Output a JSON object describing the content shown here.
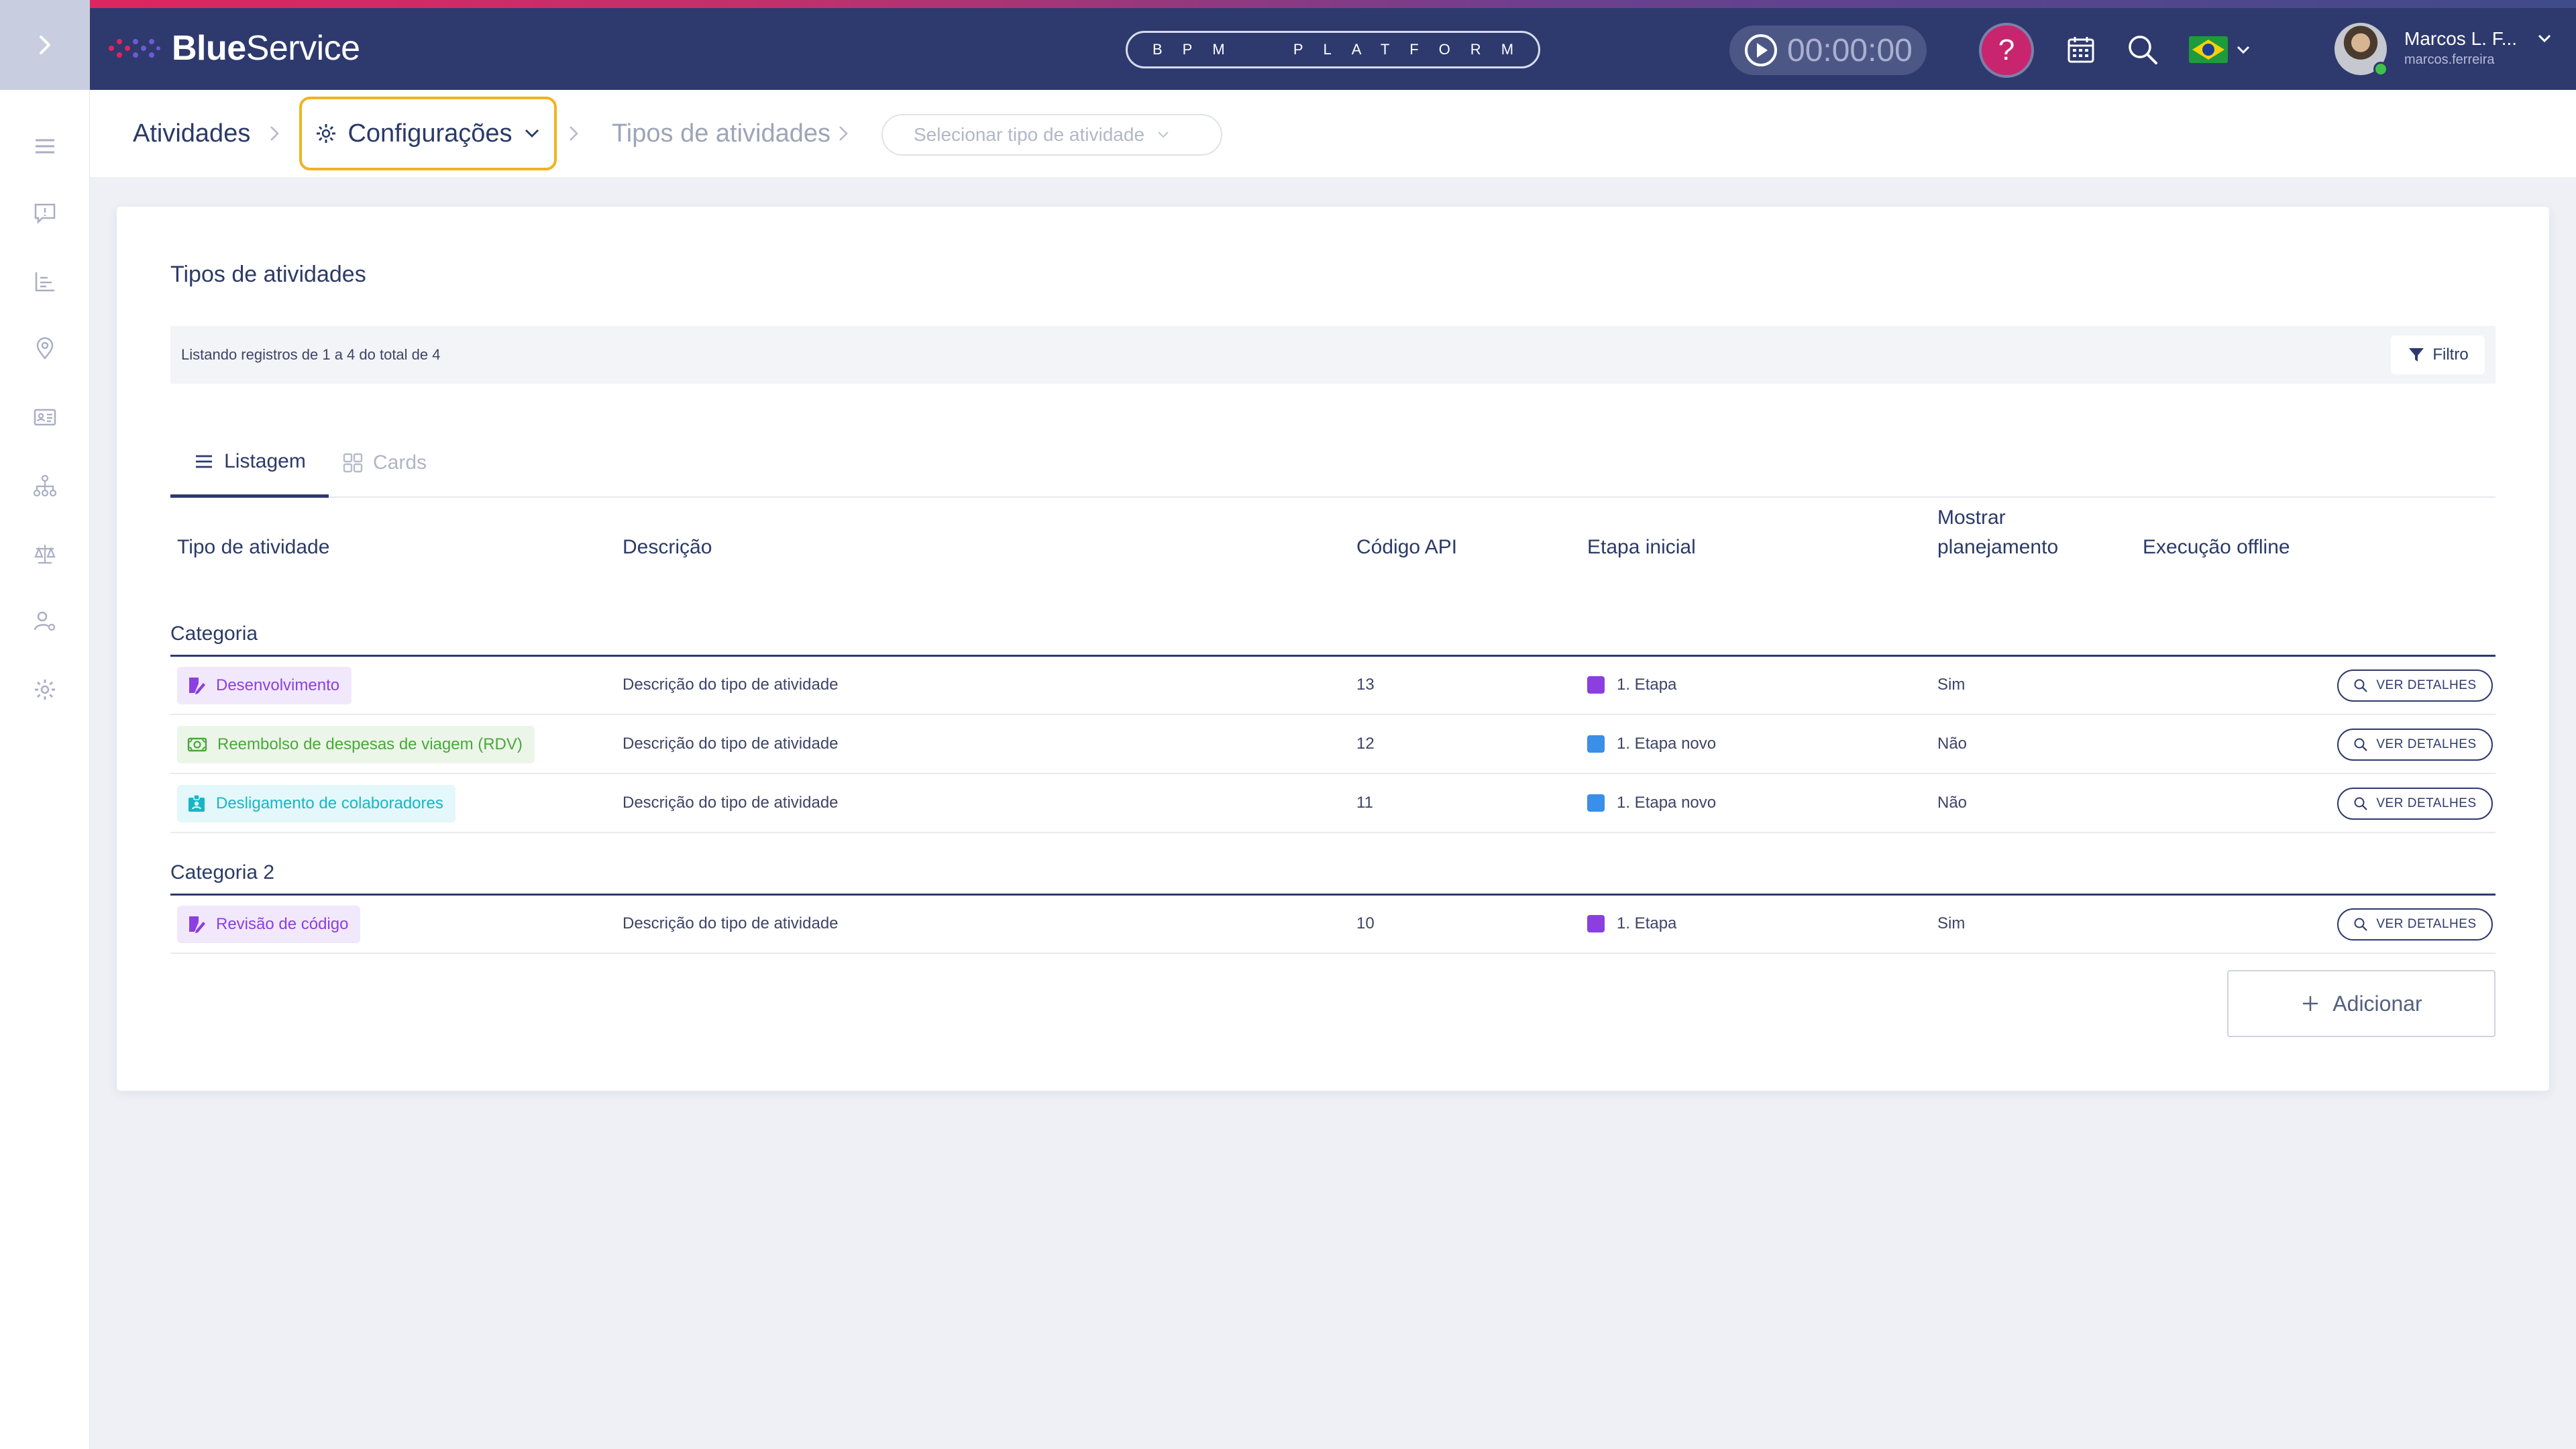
{
  "header": {
    "logo_bold": "Blue",
    "logo_light": "Service",
    "platform_label": "BPM  PLATFORM",
    "timer": "00:00:00",
    "help_label": "?",
    "user_name": "Marcos L. F...",
    "user_login": "marcos.ferreira",
    "accent_color": "#c8256e",
    "bar_color": "#2e3a6e"
  },
  "breadcrumb": {
    "item1": "Atividades",
    "item2": "Configurações",
    "item3": "Tipos de atividades",
    "select_placeholder": "Selecionar tipo de atividade"
  },
  "main": {
    "title": "Tipos de atividades",
    "listing_info": "Listando registros de 1 a 4 do total de 4",
    "filter_label": "Filtro",
    "tabs": [
      {
        "label": "Listagem",
        "icon": "list-icon",
        "active": true
      },
      {
        "label": "Cards",
        "icon": "grid-icon",
        "active": false
      }
    ],
    "columns": {
      "tipo": "Tipo de atividade",
      "descricao": "Descrição",
      "codigo": "Código API",
      "etapa": "Etapa inicial",
      "mostrar_1": "Mostrar",
      "mostrar_2": "planejamento",
      "offline": "Execução offline"
    },
    "categories": [
      {
        "name": "Categoria",
        "rows": [
          {
            "tipo": "Desenvolvimento",
            "tag_color": "#8b3fe0",
            "tag_bg": "#f1e8fb",
            "icon": "edit-doc-icon",
            "descricao": "Descrição do tipo de atividade",
            "codigo": "13",
            "etapa": "1. Etapa",
            "etapa_color": "#8b3fe0",
            "mostrar": "Sim",
            "action": "VER DETALHES"
          },
          {
            "tipo": "Reembolso de despesas de viagem (RDV)",
            "tag_color": "#4aa83a",
            "tag_bg": "#ebf6e8",
            "icon": "money-icon",
            "descricao": "Descrição do tipo de atividade",
            "codigo": "12",
            "etapa": "1. Etapa novo",
            "etapa_color": "#3a8fe8",
            "mostrar": "Não",
            "action": "VER DETALHES"
          },
          {
            "tipo": "Desligamento de colaboradores",
            "tag_color": "#17b6c7",
            "tag_bg": "#e4f7fa",
            "icon": "badge-icon",
            "descricao": "Descrição do tipo de atividade",
            "codigo": "11",
            "etapa": "1. Etapa novo",
            "etapa_color": "#3a8fe8",
            "mostrar": "Não",
            "action": "VER DETALHES"
          }
        ]
      },
      {
        "name": "Categoria 2",
        "rows": [
          {
            "tipo": "Revisão de código",
            "tag_color": "#8b3fe0",
            "tag_bg": "#f1e8fb",
            "icon": "edit-doc-icon",
            "descricao": "Descrição do tipo de atividade",
            "codigo": "10",
            "etapa": "1. Etapa",
            "etapa_color": "#8b3fe0",
            "mostrar": "Sim",
            "action": "VER DETALHES"
          }
        ]
      }
    ],
    "add_label": "Adicionar"
  }
}
